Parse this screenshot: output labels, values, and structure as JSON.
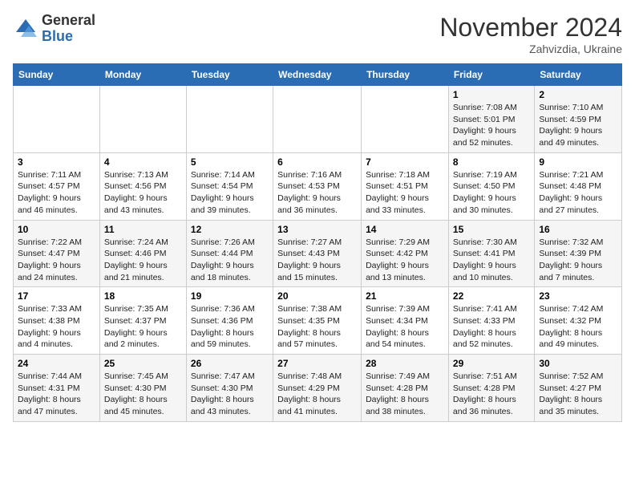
{
  "logo": {
    "general": "General",
    "blue": "Blue"
  },
  "header": {
    "month": "November 2024",
    "location": "Zahvizdia, Ukraine"
  },
  "weekdays": [
    "Sunday",
    "Monday",
    "Tuesday",
    "Wednesday",
    "Thursday",
    "Friday",
    "Saturday"
  ],
  "weeks": [
    [
      {
        "day": "",
        "info": ""
      },
      {
        "day": "",
        "info": ""
      },
      {
        "day": "",
        "info": ""
      },
      {
        "day": "",
        "info": ""
      },
      {
        "day": "",
        "info": ""
      },
      {
        "day": "1",
        "info": "Sunrise: 7:08 AM\nSunset: 5:01 PM\nDaylight: 9 hours and 52 minutes."
      },
      {
        "day": "2",
        "info": "Sunrise: 7:10 AM\nSunset: 4:59 PM\nDaylight: 9 hours and 49 minutes."
      }
    ],
    [
      {
        "day": "3",
        "info": "Sunrise: 7:11 AM\nSunset: 4:57 PM\nDaylight: 9 hours and 46 minutes."
      },
      {
        "day": "4",
        "info": "Sunrise: 7:13 AM\nSunset: 4:56 PM\nDaylight: 9 hours and 43 minutes."
      },
      {
        "day": "5",
        "info": "Sunrise: 7:14 AM\nSunset: 4:54 PM\nDaylight: 9 hours and 39 minutes."
      },
      {
        "day": "6",
        "info": "Sunrise: 7:16 AM\nSunset: 4:53 PM\nDaylight: 9 hours and 36 minutes."
      },
      {
        "day": "7",
        "info": "Sunrise: 7:18 AM\nSunset: 4:51 PM\nDaylight: 9 hours and 33 minutes."
      },
      {
        "day": "8",
        "info": "Sunrise: 7:19 AM\nSunset: 4:50 PM\nDaylight: 9 hours and 30 minutes."
      },
      {
        "day": "9",
        "info": "Sunrise: 7:21 AM\nSunset: 4:48 PM\nDaylight: 9 hours and 27 minutes."
      }
    ],
    [
      {
        "day": "10",
        "info": "Sunrise: 7:22 AM\nSunset: 4:47 PM\nDaylight: 9 hours and 24 minutes."
      },
      {
        "day": "11",
        "info": "Sunrise: 7:24 AM\nSunset: 4:46 PM\nDaylight: 9 hours and 21 minutes."
      },
      {
        "day": "12",
        "info": "Sunrise: 7:26 AM\nSunset: 4:44 PM\nDaylight: 9 hours and 18 minutes."
      },
      {
        "day": "13",
        "info": "Sunrise: 7:27 AM\nSunset: 4:43 PM\nDaylight: 9 hours and 15 minutes."
      },
      {
        "day": "14",
        "info": "Sunrise: 7:29 AM\nSunset: 4:42 PM\nDaylight: 9 hours and 13 minutes."
      },
      {
        "day": "15",
        "info": "Sunrise: 7:30 AM\nSunset: 4:41 PM\nDaylight: 9 hours and 10 minutes."
      },
      {
        "day": "16",
        "info": "Sunrise: 7:32 AM\nSunset: 4:39 PM\nDaylight: 9 hours and 7 minutes."
      }
    ],
    [
      {
        "day": "17",
        "info": "Sunrise: 7:33 AM\nSunset: 4:38 PM\nDaylight: 9 hours and 4 minutes."
      },
      {
        "day": "18",
        "info": "Sunrise: 7:35 AM\nSunset: 4:37 PM\nDaylight: 9 hours and 2 minutes."
      },
      {
        "day": "19",
        "info": "Sunrise: 7:36 AM\nSunset: 4:36 PM\nDaylight: 8 hours and 59 minutes."
      },
      {
        "day": "20",
        "info": "Sunrise: 7:38 AM\nSunset: 4:35 PM\nDaylight: 8 hours and 57 minutes."
      },
      {
        "day": "21",
        "info": "Sunrise: 7:39 AM\nSunset: 4:34 PM\nDaylight: 8 hours and 54 minutes."
      },
      {
        "day": "22",
        "info": "Sunrise: 7:41 AM\nSunset: 4:33 PM\nDaylight: 8 hours and 52 minutes."
      },
      {
        "day": "23",
        "info": "Sunrise: 7:42 AM\nSunset: 4:32 PM\nDaylight: 8 hours and 49 minutes."
      }
    ],
    [
      {
        "day": "24",
        "info": "Sunrise: 7:44 AM\nSunset: 4:31 PM\nDaylight: 8 hours and 47 minutes."
      },
      {
        "day": "25",
        "info": "Sunrise: 7:45 AM\nSunset: 4:30 PM\nDaylight: 8 hours and 45 minutes."
      },
      {
        "day": "26",
        "info": "Sunrise: 7:47 AM\nSunset: 4:30 PM\nDaylight: 8 hours and 43 minutes."
      },
      {
        "day": "27",
        "info": "Sunrise: 7:48 AM\nSunset: 4:29 PM\nDaylight: 8 hours and 41 minutes."
      },
      {
        "day": "28",
        "info": "Sunrise: 7:49 AM\nSunset: 4:28 PM\nDaylight: 8 hours and 38 minutes."
      },
      {
        "day": "29",
        "info": "Sunrise: 7:51 AM\nSunset: 4:28 PM\nDaylight: 8 hours and 36 minutes."
      },
      {
        "day": "30",
        "info": "Sunrise: 7:52 AM\nSunset: 4:27 PM\nDaylight: 8 hours and 35 minutes."
      }
    ]
  ]
}
